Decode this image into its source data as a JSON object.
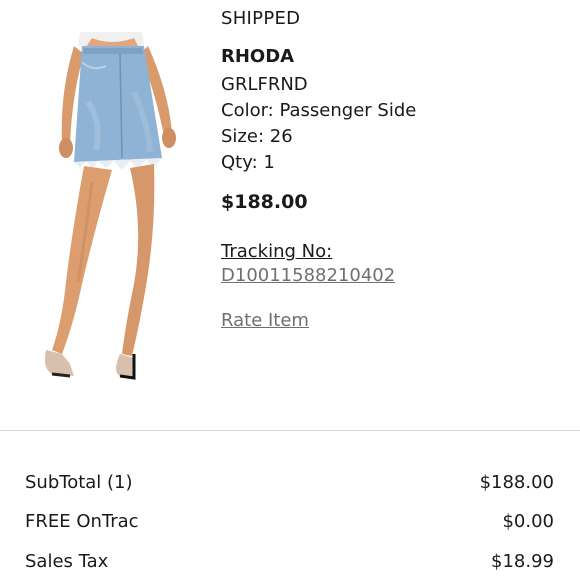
{
  "order_item": {
    "status": "SHIPPED",
    "name": "RHODA",
    "brand": "GRLFRND",
    "color": "Color: Passenger Side",
    "size": "Size: 26",
    "qty": "Qty: 1",
    "price": "$188.00",
    "tracking_label": "Tracking No:",
    "tracking_number": "D10011588210402",
    "rate_item_label": "Rate Item",
    "image_icon": "denim-skirt-photo"
  },
  "summary": {
    "rows": [
      {
        "label": "SubTotal (1)",
        "value": "$188.00"
      },
      {
        "label": "FREE OnTrac",
        "value": "$0.00"
      },
      {
        "label": "Sales Tax",
        "value": "$18.99"
      }
    ]
  },
  "colors": {
    "text": "#1a1a1a",
    "link_gray": "#707070",
    "divider": "#d4d4d4",
    "denim": "#8fb3d4"
  }
}
